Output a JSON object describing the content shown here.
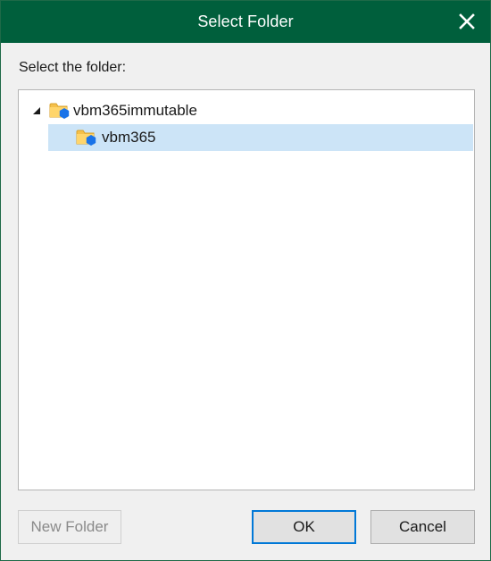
{
  "window": {
    "title": "Select Folder",
    "close_icon": "close-icon"
  },
  "prompt_label": "Select the folder:",
  "tree": {
    "root": {
      "label": "vbm365immutable",
      "icon": "object-storage-folder-icon",
      "expanded": true
    },
    "children": [
      {
        "label": "vbm365",
        "icon": "object-storage-folder-icon",
        "selected": true
      }
    ]
  },
  "buttons": {
    "new_folder": "New Folder",
    "ok": "OK",
    "cancel": "Cancel"
  },
  "colors": {
    "title_bar": "#005f3c",
    "selection": "#cce4f7",
    "folder": "#f5c04a",
    "badge": "#1a73e8",
    "default_button_border": "#0078d7"
  }
}
